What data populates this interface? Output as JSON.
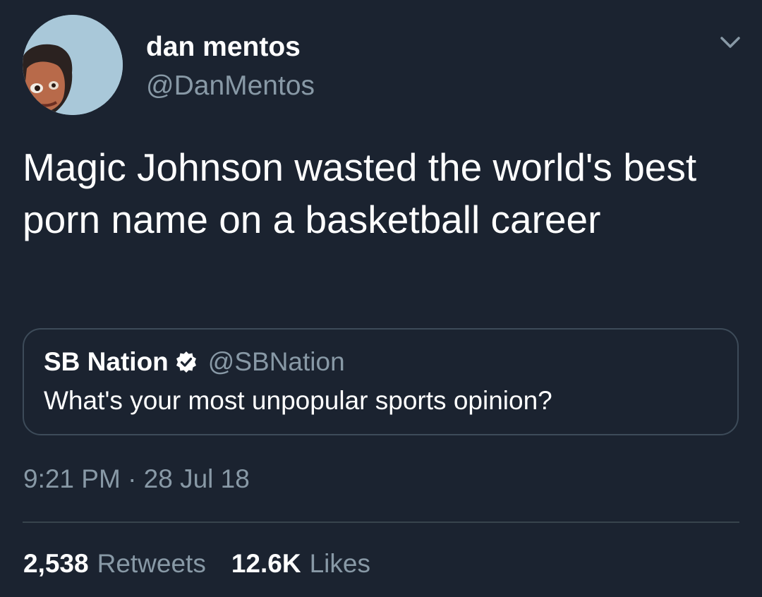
{
  "author": {
    "display_name": "dan mentos",
    "handle": "@DanMentos"
  },
  "tweet": {
    "text": "Magic Johnson wasted the world's best porn name on a basketball career",
    "timestamp": "9:21 PM · 28 Jul 18"
  },
  "quoted_tweet": {
    "display_name": "SB Nation",
    "handle": "@SBNation",
    "verified": true,
    "text": "What's your most unpopular sports opinion?"
  },
  "stats": {
    "retweets_count": "2,538",
    "retweets_label": "Retweets",
    "likes_count": "12.6K",
    "likes_label": "Likes"
  },
  "icons": {
    "menu": "chevron-down-icon",
    "verified": "verified-badge-icon"
  },
  "colors": {
    "background": "#1b2330",
    "primary_text": "#ffffff",
    "secondary_text": "#8899a6",
    "border": "#3d4b59"
  }
}
